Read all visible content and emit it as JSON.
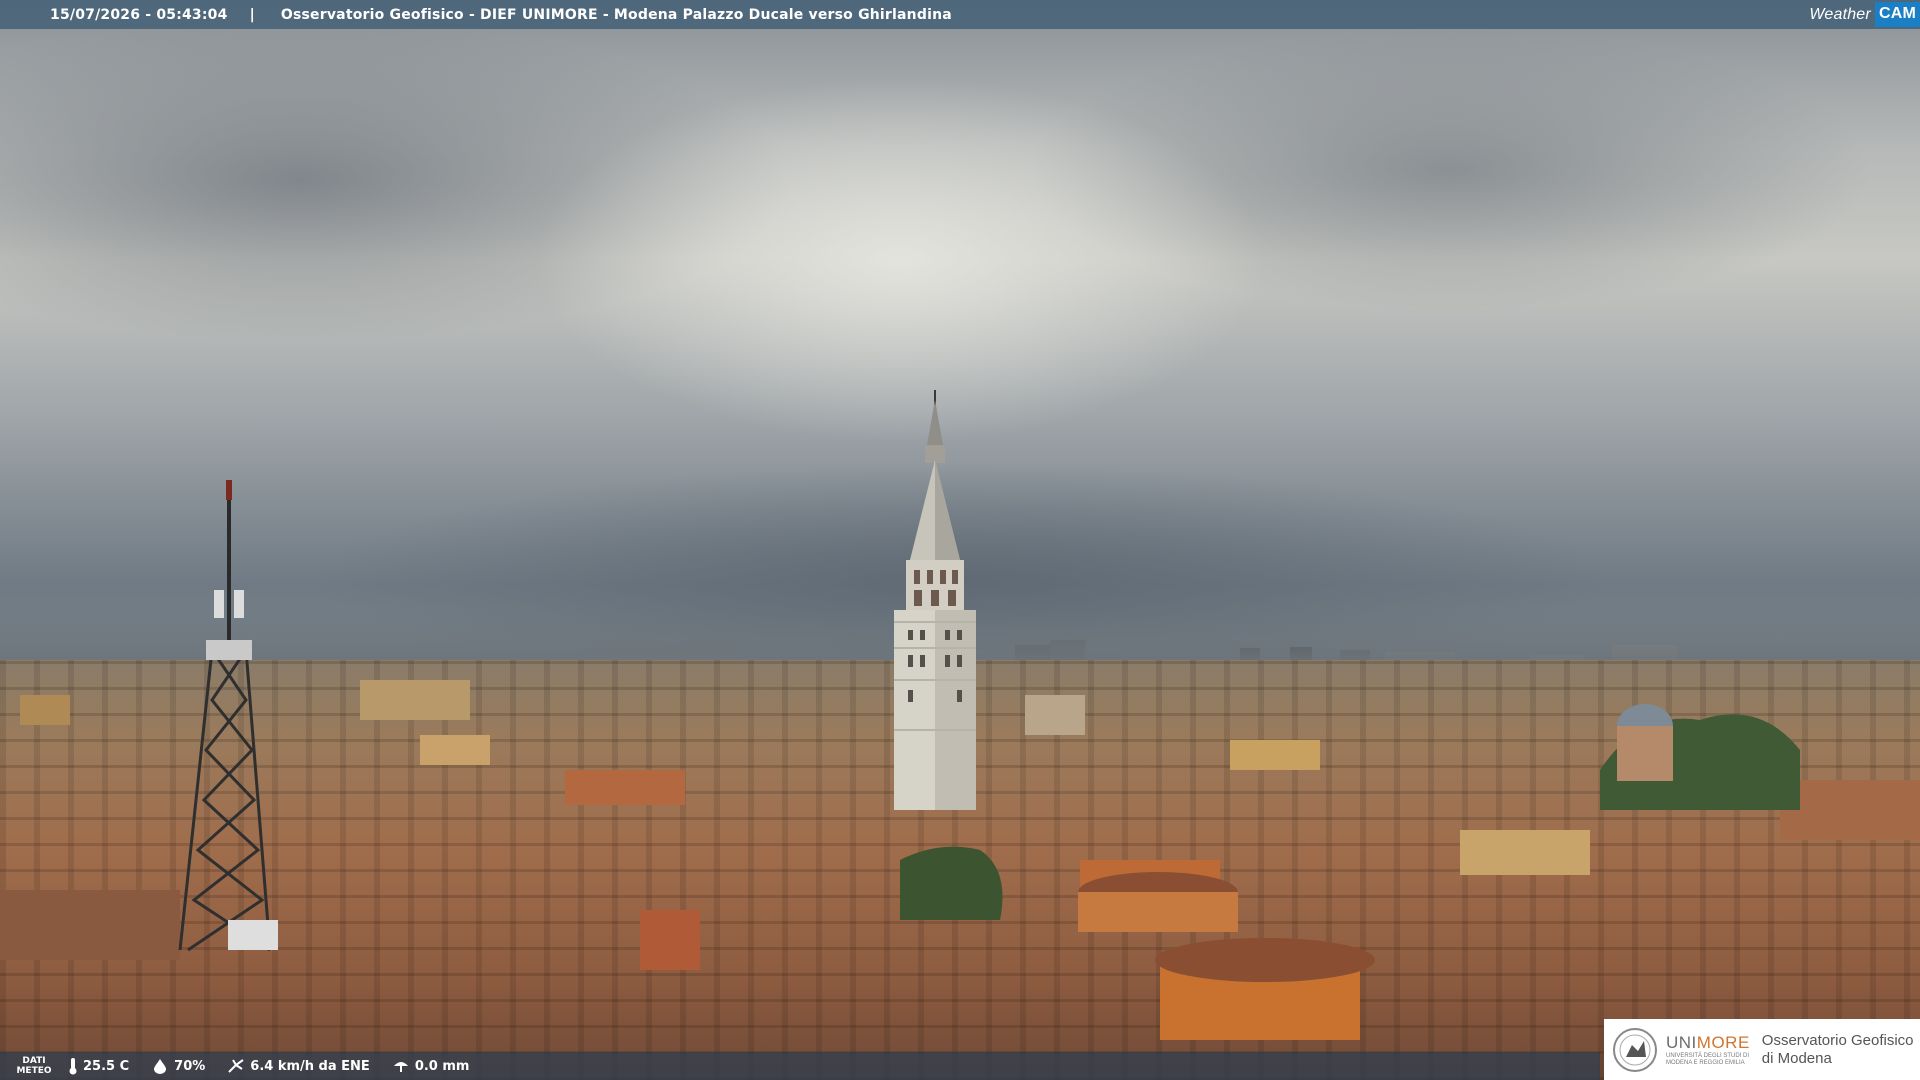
{
  "overlay": {
    "timestamp": "15/07/2026 - 05:43:04",
    "separator": "|",
    "location": "Osservatorio Geofisico - DIEF UNIMORE - Modena Palazzo Ducale verso Ghirlandina",
    "logo": {
      "part1": "Weather",
      "part2": "CAM"
    }
  },
  "meteo": {
    "label_line1": "DATI",
    "label_line2": "METEO",
    "temperature": "25.5 C",
    "humidity": "70%",
    "wind": "6.4 km/h da ENE",
    "rain": "0.0 mm",
    "icons": [
      "thermometer-icon",
      "humidity-drop-icon",
      "wind-icon",
      "rain-icon"
    ]
  },
  "sponsor": {
    "brand_prefix": "UNI",
    "brand_suffix": "MORE",
    "brand_sub_line1": "UNIVERSITÀ DEGLI STUDI DI",
    "brand_sub_line2": "MODENA E REGGIO EMILIA",
    "name_line1": "Osservatorio Geofisico",
    "name_line2": "di Modena"
  },
  "colors": {
    "topbar": "#4a6478",
    "bottombar": "#323e4e",
    "brand_orange": "#d0742e",
    "weathercam_blue": "#1a7fc4"
  }
}
